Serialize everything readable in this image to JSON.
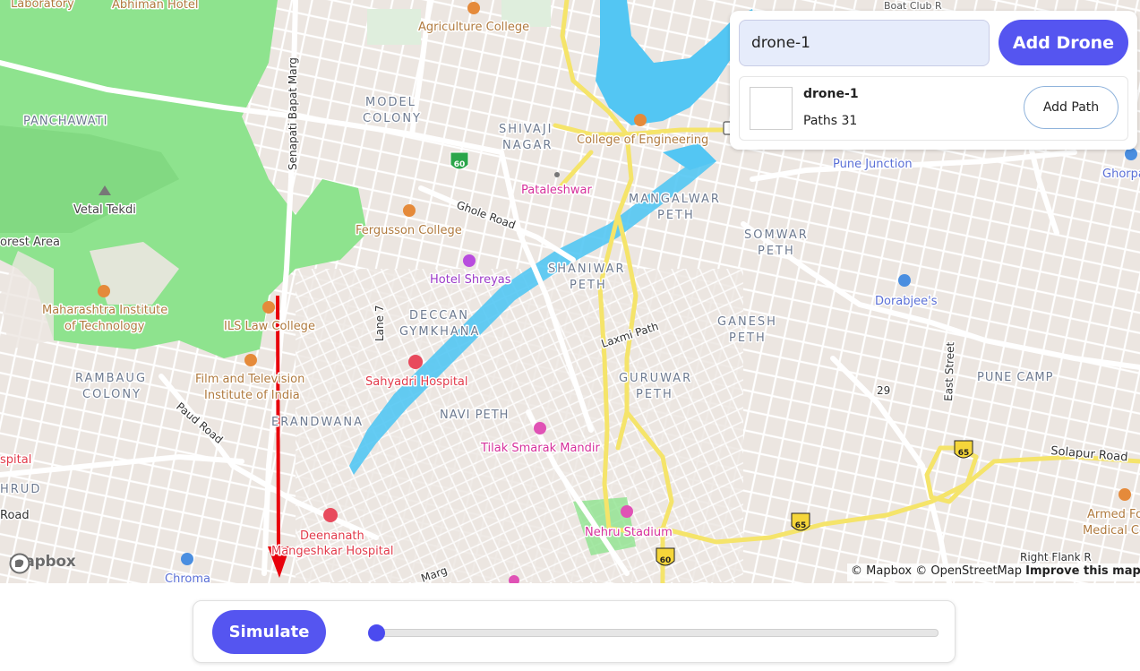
{
  "drone_panel": {
    "drone_input_value": "drone-1",
    "add_drone_label": "Add Drone",
    "drones": [
      {
        "name": "drone-1",
        "paths_text": "Paths 31",
        "add_path_label": "Add Path"
      }
    ]
  },
  "simulation": {
    "simulate_label": "Simulate",
    "progress": 0
  },
  "map": {
    "logo_text": "mapbox",
    "attribution": {
      "text": "© Mapbox © OpenStreetMap",
      "improve_link": "Improve this map"
    },
    "place_labels": {
      "laboratory": "Laboratory",
      "abhiman_hotel": "Abhiman Hotel",
      "agriculture_college": "Agriculture College",
      "boat_club": "Boat Club R",
      "panchawati": "PANCHAWATI",
      "senapati_bapat": "Senapati Bapat Marg",
      "model_colony_1": "MODEL",
      "model_colony_2": "COLONY",
      "shivaji_nagar_1": "SHIVAJI",
      "shivaji_nagar_2": "NAGAR",
      "college_engineering": "College of Engineering",
      "pune_junction": "Pune Junction",
      "ghorpadi": "Ghorpa",
      "pataleshwar": "Pataleshwar",
      "mangalwar_1": "MANGALWAR",
      "mangalwar_2": "PETH",
      "vetal_tekdi": "Vetal Tekdi",
      "ghole_road": "Ghole Road",
      "fergusson": "Fergusson College",
      "somwar_1": "SOMWAR",
      "somwar_2": "PETH",
      "forest_area": "orest Area",
      "hotel_shreyas": "Hotel Shreyas",
      "shaniwar_1": "SHANIWAR",
      "shaniwar_2": "PETH",
      "dorabjees": "Dorabjee's",
      "mit_1": "Maharashtra Institute",
      "mit_2": "of Technology",
      "ils_law": "ILS Law College",
      "lane_7": "Lane 7",
      "deccan_1": "DECCAN",
      "deccan_2": "GYMKHANA",
      "laxmi_path": "Laxmi Path",
      "ganesh_1": "GANESH",
      "ganesh_2": "PETH",
      "east_street": "East Street",
      "rambaug_1": "RAMBAUG",
      "rambaug_2": "COLONY",
      "ftii_1": "Film and Television",
      "ftii_2": "Institute of India",
      "sahyadri": "Sahyadri Hospital",
      "guruwar_1": "GURUWAR",
      "guruwar_2": "PETH",
      "pune_camp": "PUNE CAMP",
      "num_29": "29",
      "paud_road": "Paud Road",
      "erandwana": "ERANDWANA",
      "navi_peth": "NAVI PETH",
      "tilak_smarak": "Tilak Smarak Mandir",
      "solapur_road": "Solapur Road",
      "hospital_frag": "spital",
      "hrud_frag": "HRUD",
      "road_frag": "Road",
      "deenanath_1": "Deenanath",
      "deenanath_2": "Mangeshkar Hospital",
      "nehru_stadium": "Nehru Stadium",
      "armed_forces_1": "Armed Fo",
      "armed_forces_2": "Medical Co",
      "chroma": "Chroma",
      "marg": "Marg",
      "right_flank": "Right Flank R"
    },
    "shields": {
      "nh60": "60",
      "nh65": "65"
    }
  },
  "colors": {
    "accent": "#5555f0",
    "route_arrow": "#e8000b",
    "highway": "#f5e46a",
    "park": "#8ee38e",
    "river": "#53c6f3"
  }
}
